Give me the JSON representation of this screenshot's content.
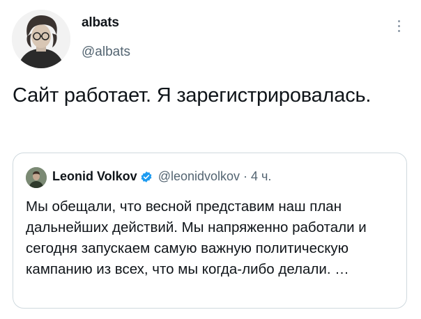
{
  "tweet": {
    "author_name": "albats",
    "author_handle": "@albats",
    "text": "Сайт работает. Я зарегистрировалась."
  },
  "quoted_tweet": {
    "author_name": "Leonid Volkov",
    "author_handle": "@leonidvolkov",
    "separator": "·",
    "time": "4 ч.",
    "verified": true,
    "text": "Мы обещали, что весной представим наш план дальнейших действий. Мы напряженно работали и сегодня запускаем самую важную политическую кампанию из всех, что мы когда-либо делали. …"
  },
  "icons": {
    "more": "more-vertical-icon",
    "verified": "verified-badge-icon"
  },
  "colors": {
    "text_primary": "#0f1419",
    "text_secondary": "#536471",
    "verified_blue": "#1d9bf0",
    "border": "#cfd9de"
  }
}
